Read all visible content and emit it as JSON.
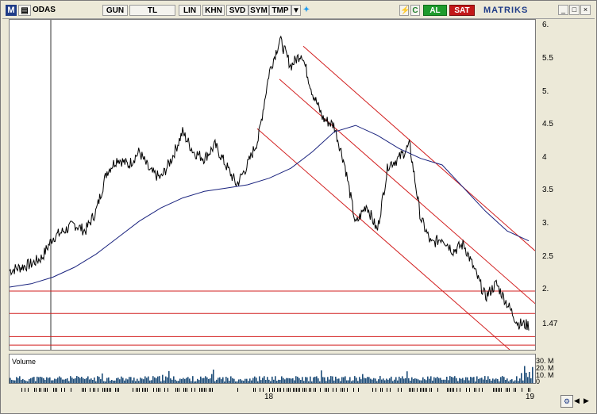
{
  "toolbar": {
    "logo": "M",
    "symbol": "ODAS",
    "period": "GUN",
    "currency": "TL",
    "scale_lin": "LIN",
    "khn": "KHN",
    "svd": "SVD",
    "sym": "SYM",
    "tmp": "TMP",
    "refresh": "C",
    "buy": "AL",
    "sell": "SAT",
    "brand": "MATRIKS"
  },
  "chart_data": {
    "type": "line",
    "price_axis_labels": [
      "6.",
      "5.5",
      "5.",
      "4.5",
      "4",
      "3.5",
      "3.",
      "2.5",
      "2.",
      "1.47"
    ],
    "last_price": "1.47",
    "volume_label": "Volume",
    "volume_axis_labels": [
      "30. M",
      "20. M",
      "10. M",
      "0"
    ],
    "x_labels": [
      "18",
      "19"
    ],
    "series": [
      {
        "name": "",
        "values": [
          2.3,
          2.35,
          2.4,
          2.5,
          2.8,
          2.9,
          3.0,
          2.9,
          3.2,
          3.8,
          4.0,
          3.9,
          4.1,
          3.8,
          3.7,
          4.0,
          4.4,
          4.1,
          4.0,
          4.2,
          3.9,
          3.6,
          3.9,
          4.3,
          5.3,
          5.8,
          5.4,
          5.6,
          5.0,
          4.6,
          4.5,
          3.9,
          3.0,
          3.3,
          2.9,
          3.9,
          4.0,
          4.2,
          3.1,
          2.7,
          2.8,
          2.6,
          2.7,
          2.3,
          1.9,
          2.1,
          1.8,
          1.5,
          1.47
        ]
      },
      {
        "name": "",
        "values": [
          2.05,
          2.1,
          2.2,
          2.35,
          2.55,
          2.8,
          3.05,
          3.25,
          3.4,
          3.5,
          3.55,
          3.6,
          3.7,
          3.85,
          4.1,
          4.4,
          4.5,
          4.35,
          4.15,
          4.0,
          3.9,
          3.55,
          3.2,
          2.9,
          2.75
        ]
      }
    ],
    "horizontal_levels": [
      1.99,
      1.65,
      1.3,
      1.17
    ],
    "ylim": [
      1.1,
      6.1
    ]
  }
}
